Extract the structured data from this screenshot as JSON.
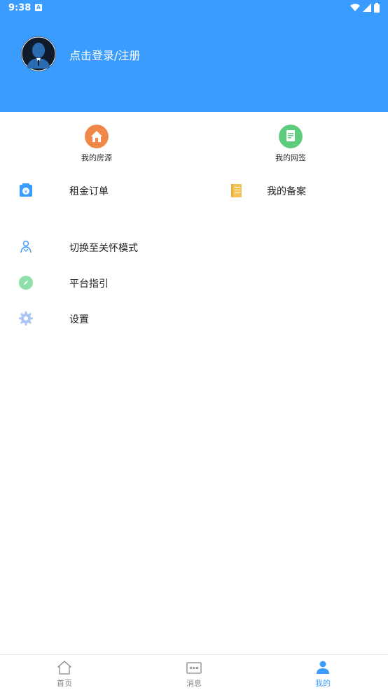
{
  "status_bar": {
    "time": "9:38",
    "a_badge": "A"
  },
  "header": {
    "login_text": "点击登录/注册"
  },
  "quick_items": [
    {
      "label": "我的房源",
      "icon": "house-icon",
      "color": "#f0884a"
    },
    {
      "label": "我的网签",
      "icon": "document-icon",
      "color": "#5dcc7c"
    }
  ],
  "menu": {
    "rent_orders": {
      "label": "租金订单",
      "icon": "yuan-card-icon"
    },
    "my_filing": {
      "label": "我的备案",
      "icon": "notebook-icon"
    },
    "care_mode": {
      "label": "切换至关怀模式",
      "icon": "elder-person-icon"
    },
    "platform_guide": {
      "label": "平台指引",
      "icon": "compass-icon"
    },
    "settings": {
      "label": "设置",
      "icon": "gear-icon"
    }
  },
  "bottom_nav": [
    {
      "label": "首页",
      "icon": "home-icon",
      "active": false
    },
    {
      "label": "消息",
      "icon": "message-icon",
      "active": false
    },
    {
      "label": "我的",
      "icon": "person-icon",
      "active": true
    }
  ],
  "colors": {
    "primary": "#3b9cff",
    "text": "#222222",
    "muted": "#888888"
  }
}
